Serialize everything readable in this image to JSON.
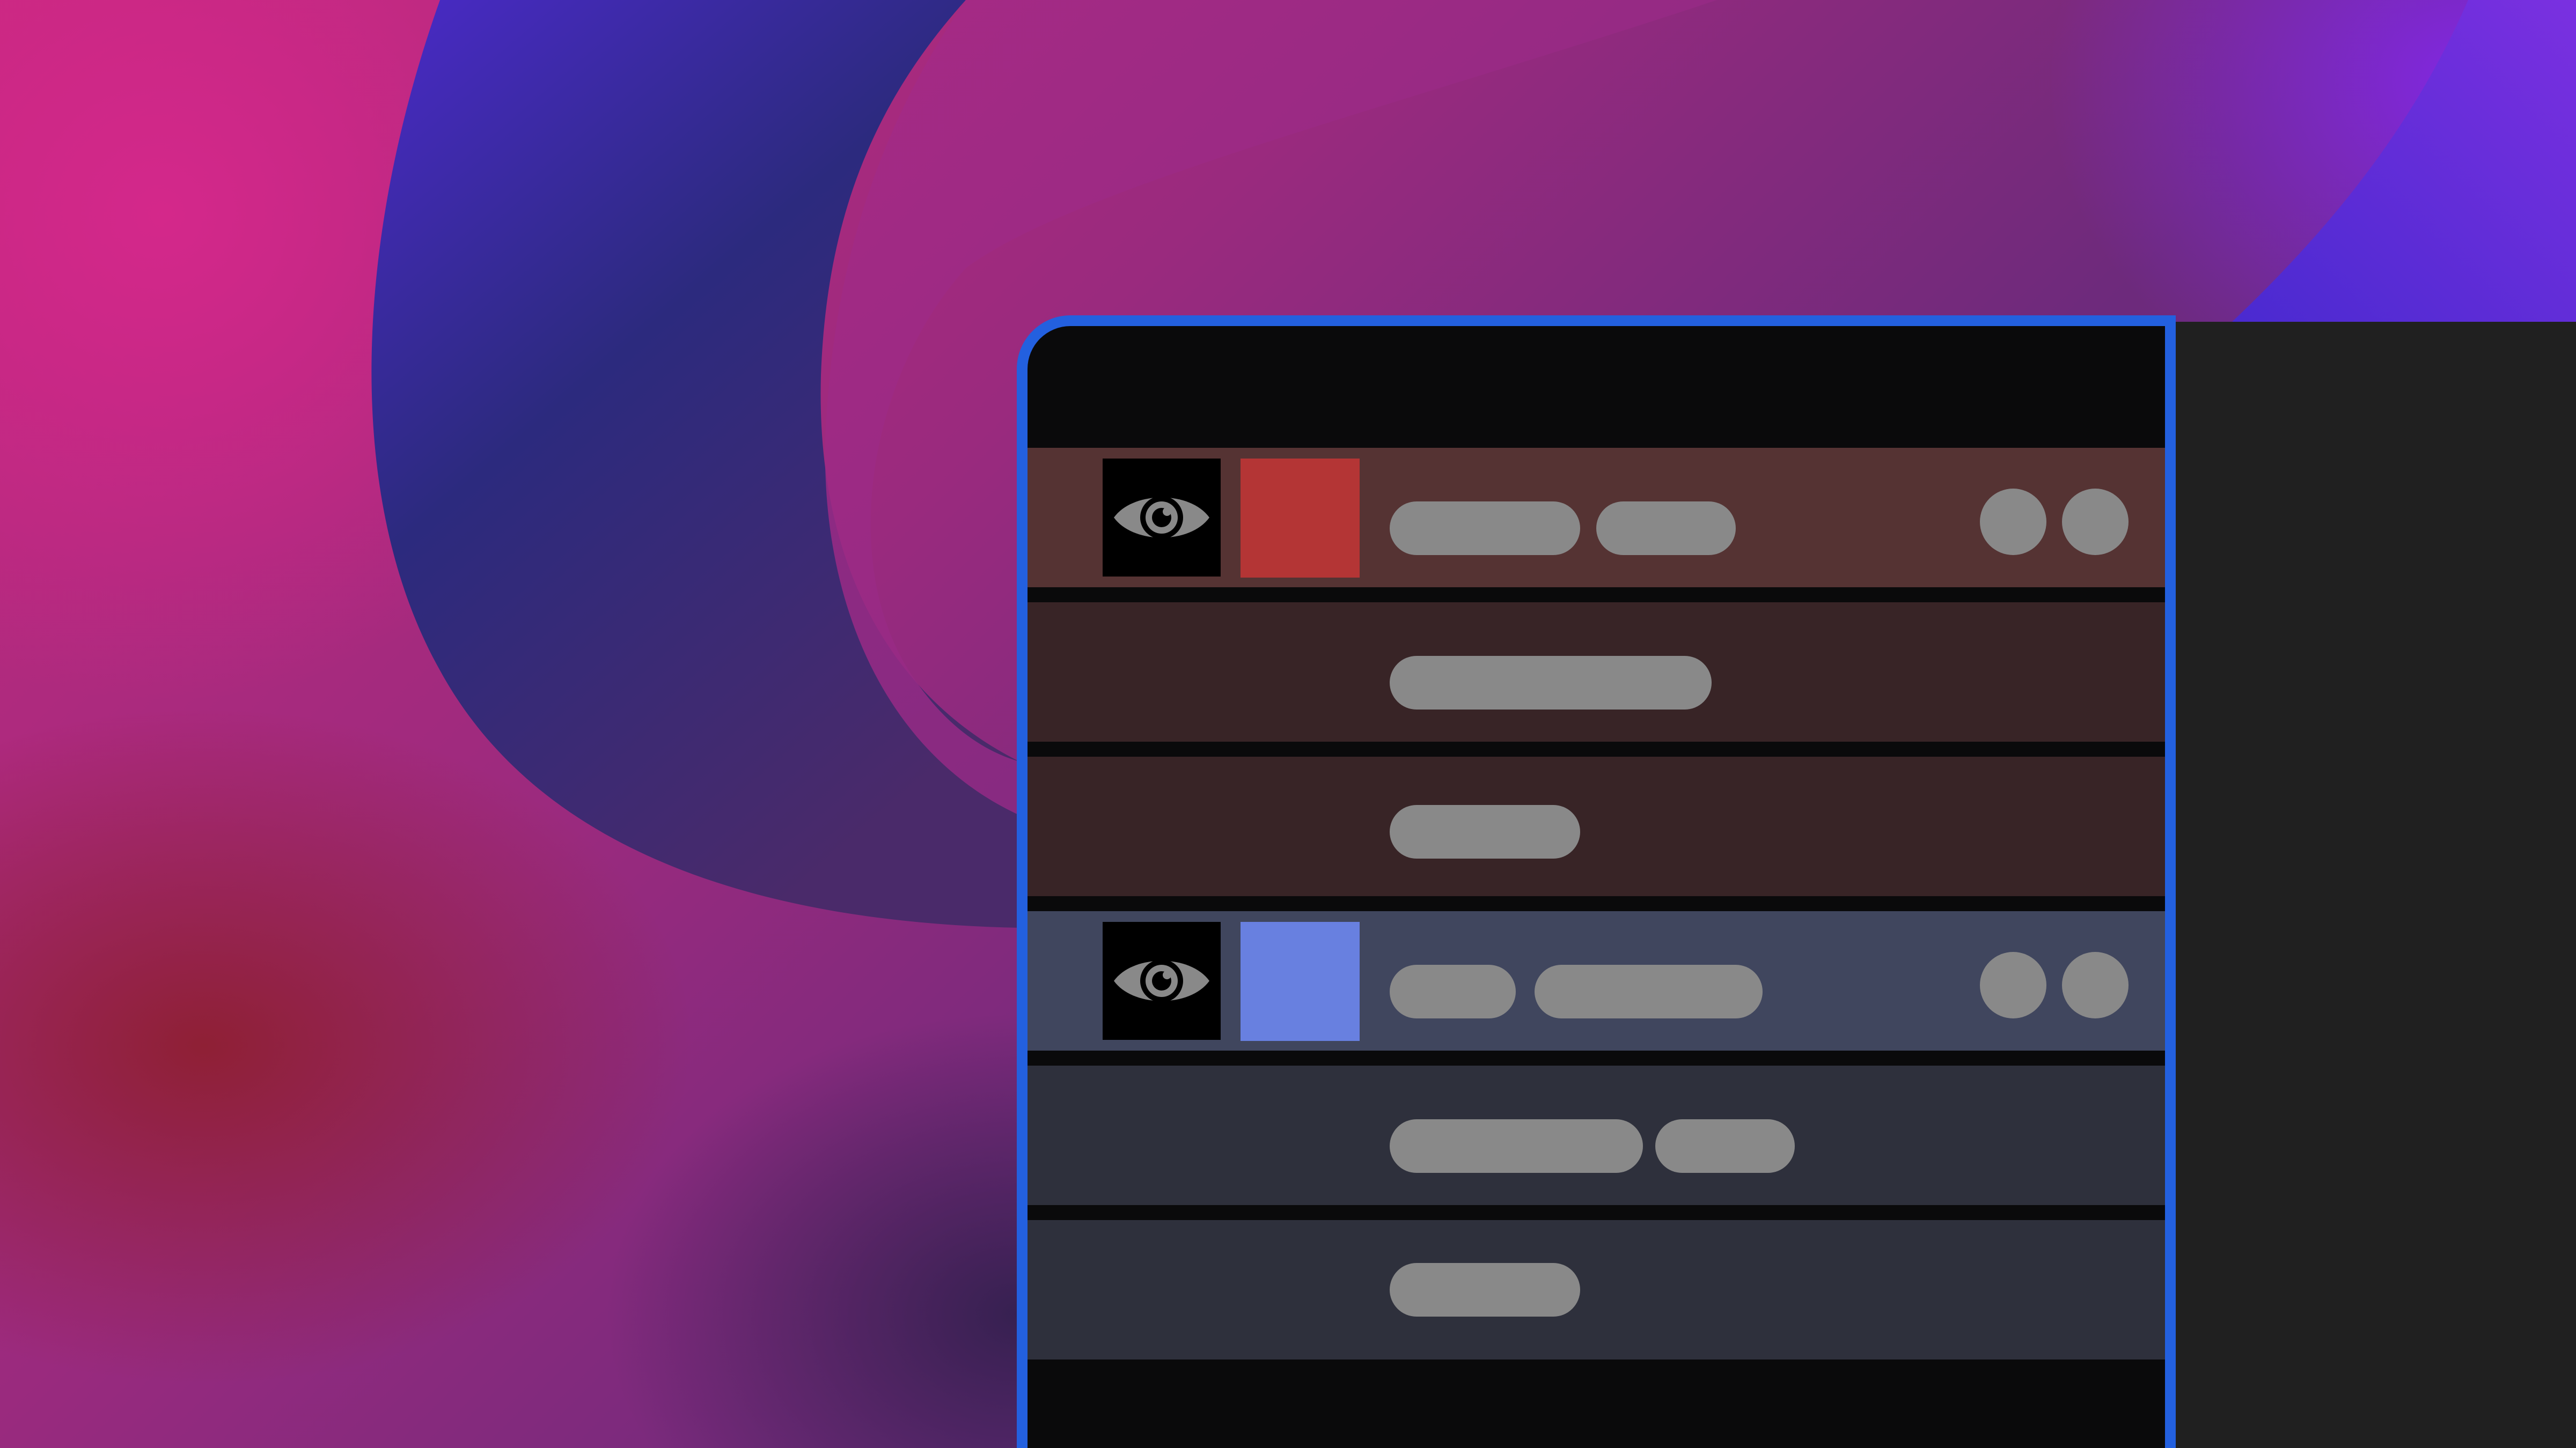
{
  "theme": {
    "window_border": "#2360df",
    "window_bg": "#0a0a0b",
    "panel_bg": "#202020",
    "placeholder_gray": "#898989",
    "eye_icon_color": "#898989"
  },
  "layers": [
    {
      "role": "group-header",
      "row_color": "#553333",
      "visibility_icon": "eye-icon",
      "swatch_color": "#b43535",
      "has_actions": true
    },
    {
      "role": "child",
      "row_color": "#382426"
    },
    {
      "role": "child",
      "row_color": "#382426"
    },
    {
      "role": "group-header",
      "row_color": "#40465e",
      "visibility_icon": "eye-icon",
      "swatch_color": "#6880e0",
      "has_actions": true
    },
    {
      "role": "child",
      "row_color": "#2e303c"
    },
    {
      "role": "child",
      "row_color": "#2e303c"
    }
  ]
}
